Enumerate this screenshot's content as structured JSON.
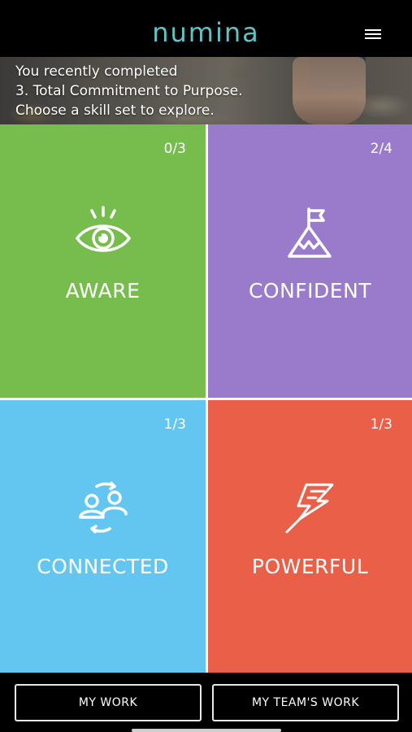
{
  "app": {
    "logo_text": "numina",
    "logo_color": "#5fc4c6",
    "menu_icon": "hamburger-menu-icon"
  },
  "banner": {
    "line1": "You recently completed",
    "line2": "3. Total Commitment to Purpose.",
    "line3": "Choose a skill set to explore."
  },
  "tiles": [
    {
      "label": "AWARE",
      "count": "0/3",
      "icon": "eye-icon",
      "color": "#77bd4e"
    },
    {
      "label": "CONFIDENT",
      "count": "2/4",
      "icon": "mountain-flag-icon",
      "color": "#9a7acb"
    },
    {
      "label": "CONNECTED",
      "count": "1/3",
      "icon": "people-cycle-icon",
      "color": "#62c6f0"
    },
    {
      "label": "POWERFUL",
      "count": "1/3",
      "icon": "lightning-icon",
      "color": "#ea5f48"
    }
  ],
  "bottom_nav": {
    "my_work": "MY WORK",
    "my_teams_work": "MY TEAM'S WORK"
  }
}
